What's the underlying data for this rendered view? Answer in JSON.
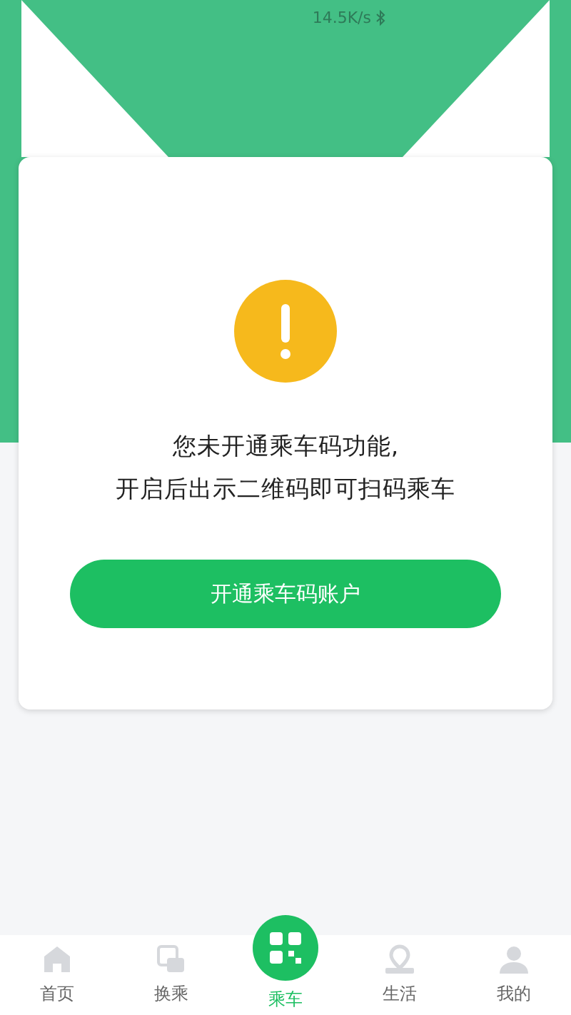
{
  "status_bar": {
    "speed": "14.5K/s"
  },
  "notice": {
    "message_lines": [
      "您未开通乘车码功能,",
      "开启后出示二维码即可扫码乘车"
    ],
    "button": "开通乘车码账户"
  },
  "tabs": [
    {
      "label": "首页",
      "selected": false
    },
    {
      "label": "换乘",
      "selected": false
    },
    {
      "label": "乘车",
      "selected": true
    },
    {
      "label": "生活",
      "selected": false
    },
    {
      "label": "我的",
      "selected": false
    }
  ]
}
